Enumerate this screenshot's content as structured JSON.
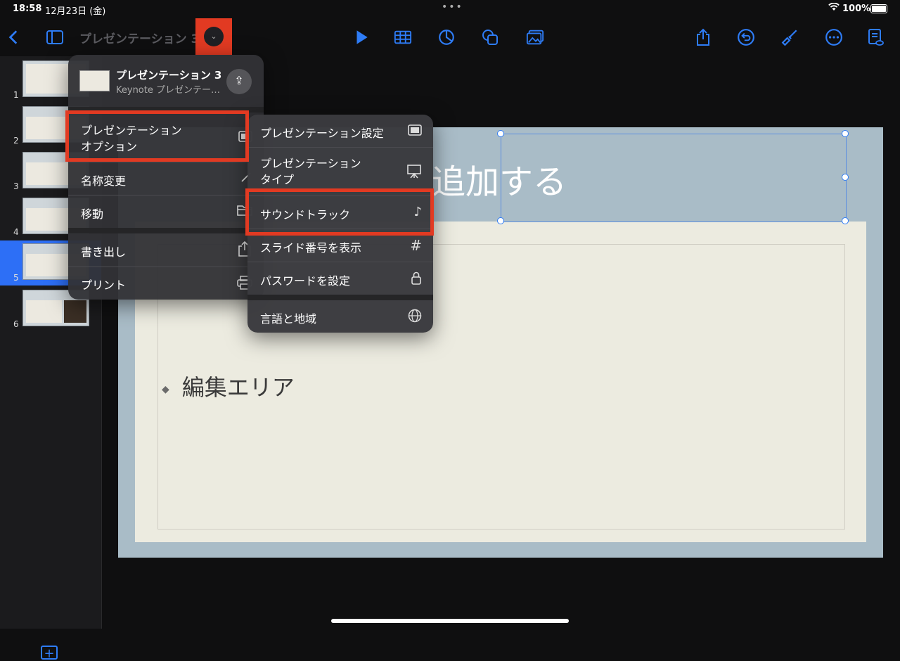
{
  "status_bar": {
    "time": "18:58",
    "date": "12月23日 (金)",
    "dots": "•••",
    "battery": "100%"
  },
  "toolbar": {
    "document_title": "プレゼンテーション 3",
    "icons": [
      "back-icon",
      "sidebar-icon",
      "play-icon",
      "table-icon",
      "chart-icon",
      "shape-icon",
      "media-icon",
      "share-icon",
      "undo-icon",
      "format-brush-icon",
      "more-icon",
      "presenter-notes-icon"
    ],
    "accent_color": "#2e7cf6"
  },
  "slides": [
    {
      "number": "1"
    },
    {
      "number": "2"
    },
    {
      "number": "3"
    },
    {
      "number": "4"
    },
    {
      "number": "5",
      "selected": true
    },
    {
      "number": "6"
    }
  ],
  "slide": {
    "title": "追加する",
    "bullet": "編集エリア"
  },
  "file_menu": {
    "file_name": "プレゼンテーション 3",
    "file_type": "Keynote プレゼンテー…",
    "items": [
      {
        "label": "プレゼンテーション\nオプション",
        "icon": "presentation-icon"
      },
      {
        "label": "名称変更",
        "icon": "pencil-icon"
      },
      {
        "label": "移動",
        "icon": "folder-icon"
      },
      {
        "label": "書き出し",
        "icon": "export-icon"
      },
      {
        "label": "プリント",
        "icon": "printer-icon"
      }
    ]
  },
  "options_menu": {
    "items": [
      {
        "label": "プレゼンテーション設定",
        "icon": "presentation-settings-icon"
      },
      {
        "label": "プレゼンテーション\nタイプ",
        "icon": "easel-icon"
      },
      {
        "label": "サウンドトラック",
        "icon": "music-note-icon"
      },
      {
        "label": "スライド番号を表示",
        "icon": "hash-icon"
      },
      {
        "label": "パスワードを設定",
        "icon": "lock-icon"
      },
      {
        "label": "言語と地域",
        "icon": "globe-icon"
      }
    ]
  },
  "highlight_color": "#e23a22"
}
